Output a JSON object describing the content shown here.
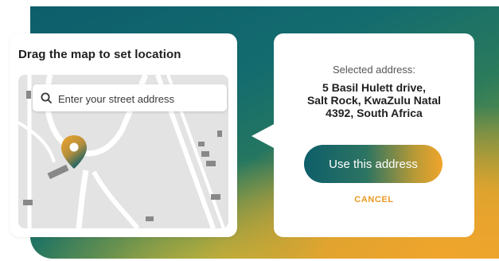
{
  "left_card": {
    "title": "Drag the map to set location",
    "search": {
      "placeholder": "Enter your street address",
      "icon": "search-icon"
    },
    "pin_icon": "map-pin-icon"
  },
  "right_card": {
    "label": "Selected address:",
    "address_line1": "5 Basil Hulett drive,",
    "address_line2": "Salt Rock, KwaZulu Natal",
    "address_line3": "4392, South Africa",
    "use_button_label": "Use this address",
    "cancel_label": "CANCEL"
  },
  "colors": {
    "teal": "#0e5e6a",
    "orange": "#f0a52c",
    "map_bg": "#e3e3e3",
    "cancel": "#ec9a22"
  }
}
